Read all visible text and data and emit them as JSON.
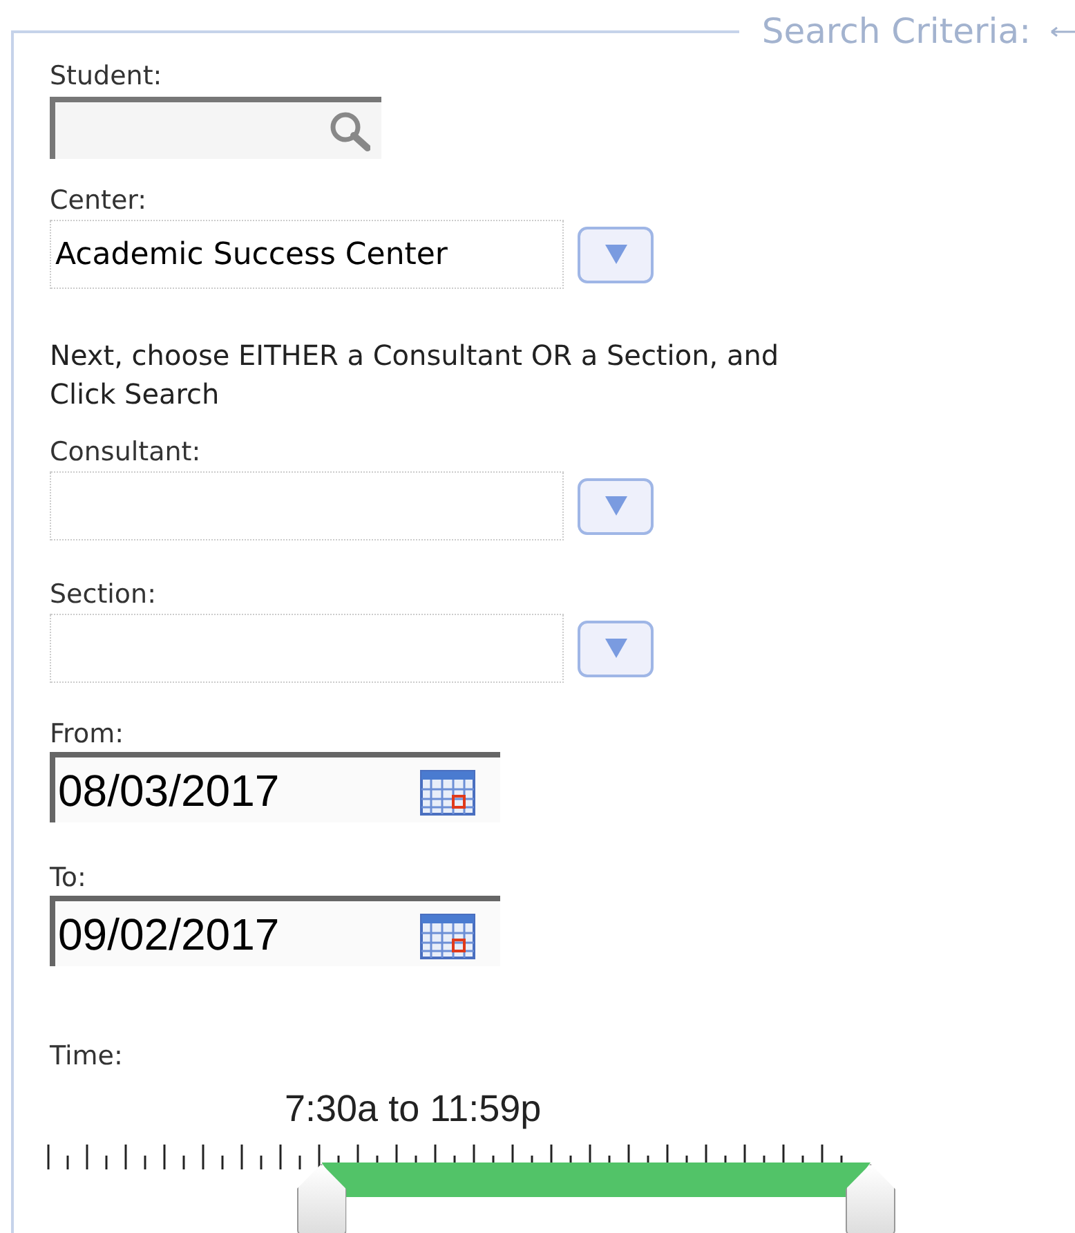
{
  "panel": {
    "legend": "Search Criteria:"
  },
  "student": {
    "label": "Student:"
  },
  "center": {
    "label": "Center:",
    "value": "Academic Success Center"
  },
  "instructions": "Next, choose EITHER a Consultant OR a Section, and Click Search",
  "consultant": {
    "label": "Consultant:"
  },
  "section": {
    "label": "Section:"
  },
  "from": {
    "label": "From:",
    "value": "08/03/2017"
  },
  "to": {
    "label": "To:",
    "value": "09/02/2017"
  },
  "time": {
    "label": "Time:",
    "reading": "7:30a to 11:59p",
    "thumbs": [
      {
        "level": 0.3125
      },
      {
        "level": 1
      }
    ]
  }
}
